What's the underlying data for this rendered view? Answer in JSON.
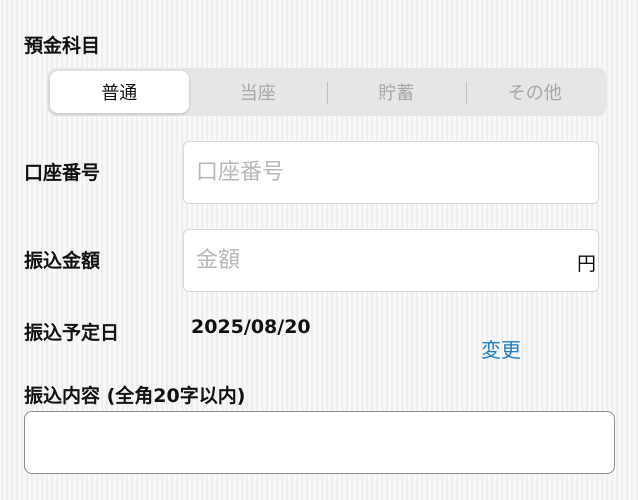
{
  "account_type": {
    "label": "預金科目",
    "options": [
      {
        "label": "普通",
        "selected": true
      },
      {
        "label": "当座",
        "selected": false
      },
      {
        "label": "貯蓄",
        "selected": false
      },
      {
        "label": "その他",
        "selected": false
      }
    ]
  },
  "account_number": {
    "label": "口座番号",
    "placeholder": "口座番号",
    "value": ""
  },
  "amount": {
    "label": "振込金額",
    "placeholder": "金額",
    "value": "",
    "unit": "円"
  },
  "transfer_date": {
    "label": "振込予定日",
    "value": "2025/08/20",
    "change_label": "変更"
  },
  "transfer_content": {
    "label": "振込内容 (全角20字以内)",
    "value": ""
  },
  "colors": {
    "link": "#1f7fc9",
    "placeholder": "#b8b8b8",
    "segment_background": "#e6e6e8"
  }
}
